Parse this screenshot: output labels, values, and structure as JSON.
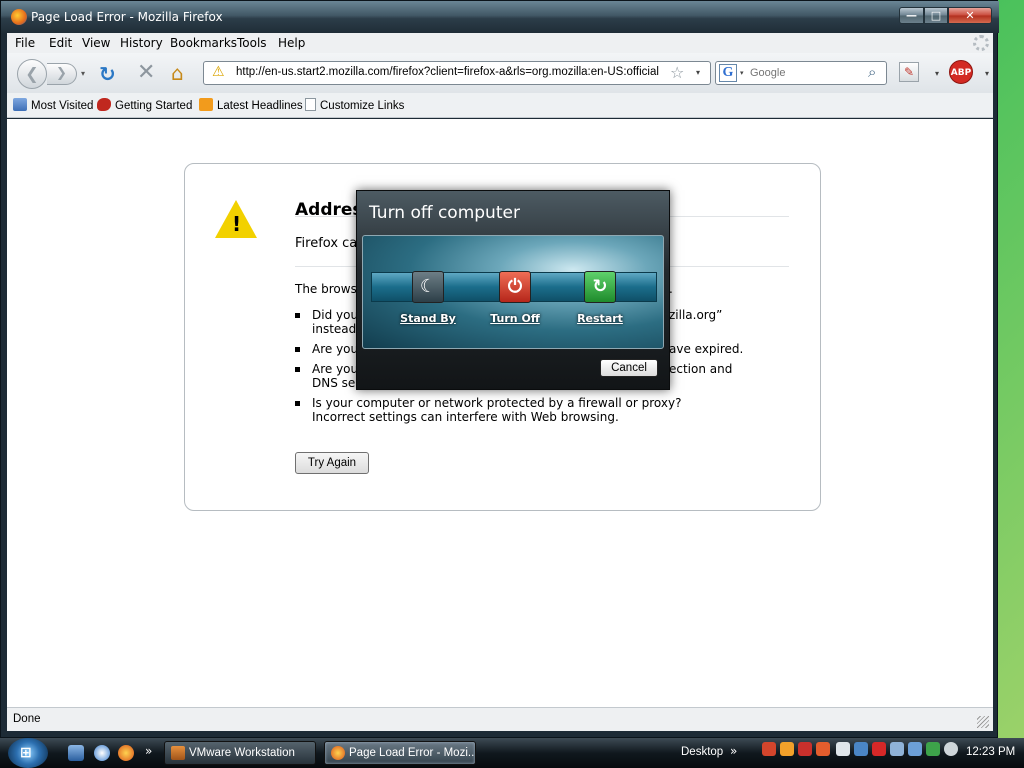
{
  "window": {
    "title": "Page Load Error - Mozilla Firefox",
    "minimize": "—",
    "maximize": "□",
    "close": "✕"
  },
  "menu": {
    "file": "File",
    "edit": "Edit",
    "view": "View",
    "history": "History",
    "bookmarks": "Bookmarks",
    "tools": "Tools",
    "help": "Help"
  },
  "toolbar": {
    "back": "❮",
    "forward": "❯",
    "dropdown": "▾",
    "reload": "↻",
    "stop": "✕",
    "home": "⌂",
    "url": "http://en-us.start2.mozilla.com/firefox?client=firefox-a&rls=org.mozilla:en-US:official",
    "url_warning": "⚠",
    "star": "☆",
    "search_engine": "G",
    "search_placeholder": "Google",
    "search_go": "⌕",
    "abp": "ABP"
  },
  "bookmarks": {
    "most_visited": "Most Visited",
    "getting_started": "Getting Started",
    "latest_headlines": "Latest Headlines",
    "customize_links": "Customize Links"
  },
  "error_page": {
    "title": "Addres",
    "subtitle": "Firefox ca",
    "browse_line": "The browse",
    "browse_end": ".",
    "bullet1_start": "Did you",
    "bullet1_cont": "instead",
    "bullet1_tail": "zilla.org”",
    "bullet2_start": "Are you",
    "bullet2_tail": "ave expired.",
    "bullet3_start": "Are you",
    "bullet3_cont": "DNS ser",
    "bullet3_tail": "ection and",
    "bullet4": "Is your computer or network protected by a firewall or proxy? Incorrect settings can interfere with Web browsing.",
    "try_again": "Try Again"
  },
  "status": {
    "text": "Done"
  },
  "dialog": {
    "title": "Turn off computer",
    "stand_by": "Stand By",
    "turn_off": "Turn Off",
    "restart": "Restart",
    "cancel": "Cancel",
    "stand_by_glyph": "☾",
    "turn_off_glyph": "⏻",
    "restart_glyph": "↻"
  },
  "taskbar": {
    "start_logo": "⊞",
    "quicklaunch_more": "»",
    "tasks": [
      {
        "label": "VMware Workstation"
      },
      {
        "label": "Page Load Error - Mozi..."
      }
    ],
    "desktop": "Desktop",
    "desktop_more": "»",
    "clock": "12:23 PM"
  },
  "colors": {
    "accent_error": "#c0352b",
    "warning": "#f2d100",
    "turn_off": "#b5261a",
    "restart": "#1f8b2c"
  }
}
